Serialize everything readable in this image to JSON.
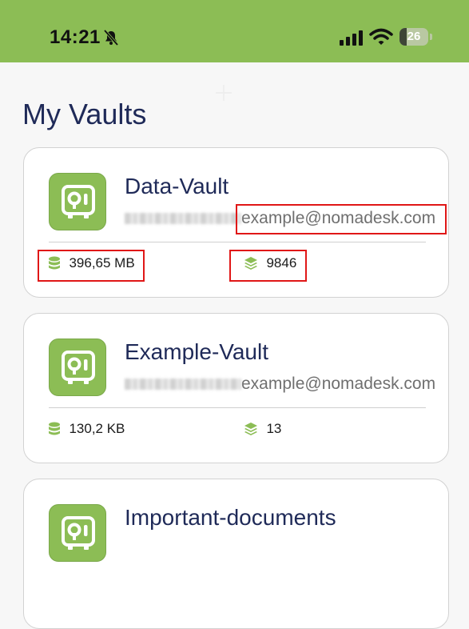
{
  "status_bar": {
    "time": "14:21",
    "battery_percent": "26",
    "battery_level": 0.26,
    "icons": [
      "bell-off-icon",
      "cellular-signal-icon",
      "wifi-icon",
      "battery-icon"
    ],
    "background_color": "#8cbd55"
  },
  "page": {
    "title": "My Vaults"
  },
  "vaults": [
    {
      "name": "Data-Vault",
      "owner_domain": "example@nomadesk.com",
      "size": "396,65 MB",
      "items": "9846",
      "highlighted": true
    },
    {
      "name": "Example-Vault",
      "owner_domain": "example@nomadesk.com",
      "size": "130,2 KB",
      "items": "13",
      "highlighted": false
    },
    {
      "name": "Important-documents",
      "owner_domain": "",
      "size": "",
      "items": "",
      "highlighted": false
    }
  ],
  "colors": {
    "accent": "#8cbd55",
    "title": "#1f2a58",
    "highlight": "#e01717"
  }
}
